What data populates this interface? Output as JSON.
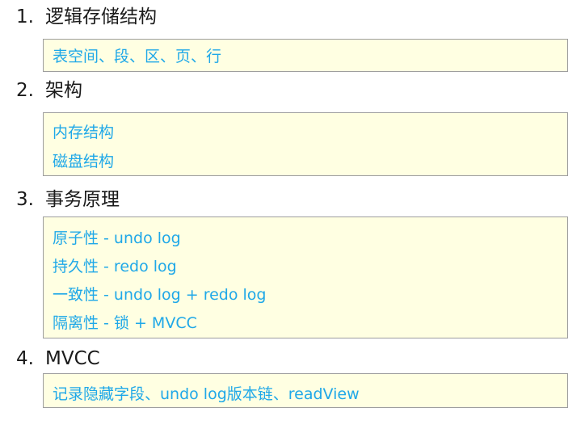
{
  "sections": [
    {
      "number": "1.",
      "title": "逻辑存储结构",
      "items": [
        "表空间、段、区、页、行"
      ]
    },
    {
      "number": "2.",
      "title": "架构",
      "items": [
        "内存结构",
        "磁盘结构"
      ]
    },
    {
      "number": "3.",
      "title": "事务原理",
      "items": [
        "原子性 - undo log",
        "持久性 - redo log",
        "一致性 - undo log + redo log",
        "隔离性 - 锁 + MVCC"
      ]
    },
    {
      "number": "4.",
      "title": "MVCC",
      "items": [
        "记录隐藏字段、undo log版本链、readView"
      ]
    }
  ],
  "colors": {
    "note_background": "#ffffe2",
    "note_border": "#9e9e9e",
    "note_text": "#1fa8e8",
    "heading_text": "#1a1a1a"
  }
}
